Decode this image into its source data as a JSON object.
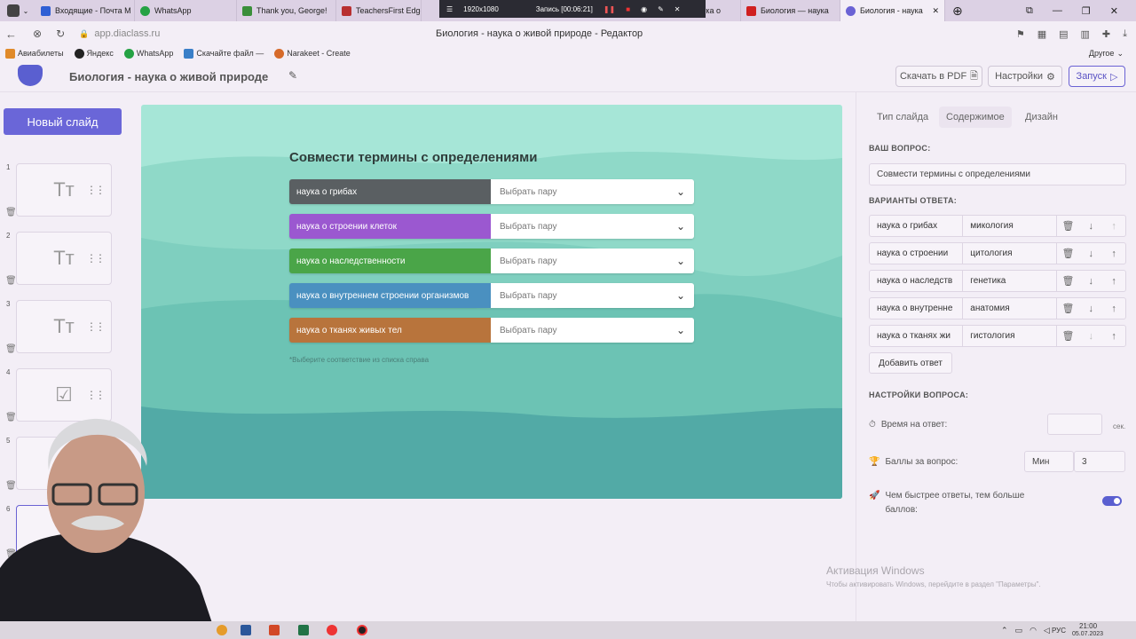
{
  "browser": {
    "tabs": [
      {
        "label": "Входящие - Почта М",
        "color": "#2f5fd4"
      },
      {
        "label": "WhatsApp",
        "color": "#25a244"
      },
      {
        "label": "Thank you, George!",
        "color": "#3a8f3a"
      },
      {
        "label": "TeachersFirst Edge",
        "color": "#b83030"
      },
      {
        "label": "наука о",
        "color": "#b83030"
      },
      {
        "label": "Биология — наука",
        "color": "#d02020"
      },
      {
        "label": "Биология - наука",
        "color": "#6a62d4"
      }
    ],
    "recorder": {
      "resolution": "1920x1080",
      "status": "Запись [00:06:21]"
    },
    "url": "app.diaclass.ru",
    "page_title": "Биология - наука о живой природе - Редактор",
    "bookmarks": [
      "Авиабилеты",
      "Яндекс",
      "WhatsApp",
      "Скачайте файл —",
      "Narakeet - Create"
    ],
    "other_bookmarks": "Другое"
  },
  "app": {
    "title": "Биология - наука о живой природе",
    "download_pdf": "Скачать в PDF",
    "settings": "Настройки",
    "launch": "Запуск",
    "new_slide": "Новый слайд"
  },
  "slides": [
    {
      "num": "1",
      "icon": "Tт"
    },
    {
      "num": "2",
      "icon": "Tт"
    },
    {
      "num": "3",
      "icon": "Tт"
    },
    {
      "num": "4",
      "icon": "☑"
    },
    {
      "num": "5",
      "icon": "✎"
    },
    {
      "num": "6",
      "icon": "⤨"
    }
  ],
  "slide": {
    "heading": "Совмести термины с определениями",
    "rows": [
      {
        "term": "наука о грибах",
        "color": "#5a5f62"
      },
      {
        "term": "наука о строении клеток",
        "color": "#9b58d0"
      },
      {
        "term": "наука о наследственности",
        "color": "#4aa548"
      },
      {
        "term": "наука о внутреннем строении организмов",
        "color": "#4a90c0"
      },
      {
        "term": "наука о тканях живых тел",
        "color": "#b8743c"
      }
    ],
    "select_placeholder": "Выбрать пару",
    "hint": "*Выберите соответствие из списка справа"
  },
  "right": {
    "tabs": [
      "Тип слайда",
      "Содержимое",
      "Дизайн"
    ],
    "question_label": "ВАШ ВОПРОС:",
    "question_value": "Совмести термины с определениями",
    "answers_label": "ВАРИАНТЫ ОТВЕТА:",
    "answers": [
      {
        "a": "наука о грибах",
        "b": "микология"
      },
      {
        "a": "наука о строении",
        "b": "цитология"
      },
      {
        "a": "наука о наследств",
        "b": "генетика"
      },
      {
        "a": "наука о внутренне",
        "b": "анатомия"
      },
      {
        "a": "наука о тканях жи",
        "b": "гистология"
      }
    ],
    "add_answer": "Добавить ответ",
    "settings_label": "НАСТРОЙКИ ВОПРОСА:",
    "time_label": "Время на ответ:",
    "time_unit": "сек.",
    "points_label": "Баллы за вопрос:",
    "points_min": "Мин",
    "points_value": "3",
    "speed_label": "Чем быстрее ответы, тем больше баллов:",
    "speed_on": true
  },
  "windows": {
    "activate_title": "Активация Windows",
    "activate_sub": "Чтобы активировать Windows, перейдите в раздел \"Параметры\".",
    "lang": "РУС",
    "time": "21:00",
    "date": "05.07.2023"
  }
}
